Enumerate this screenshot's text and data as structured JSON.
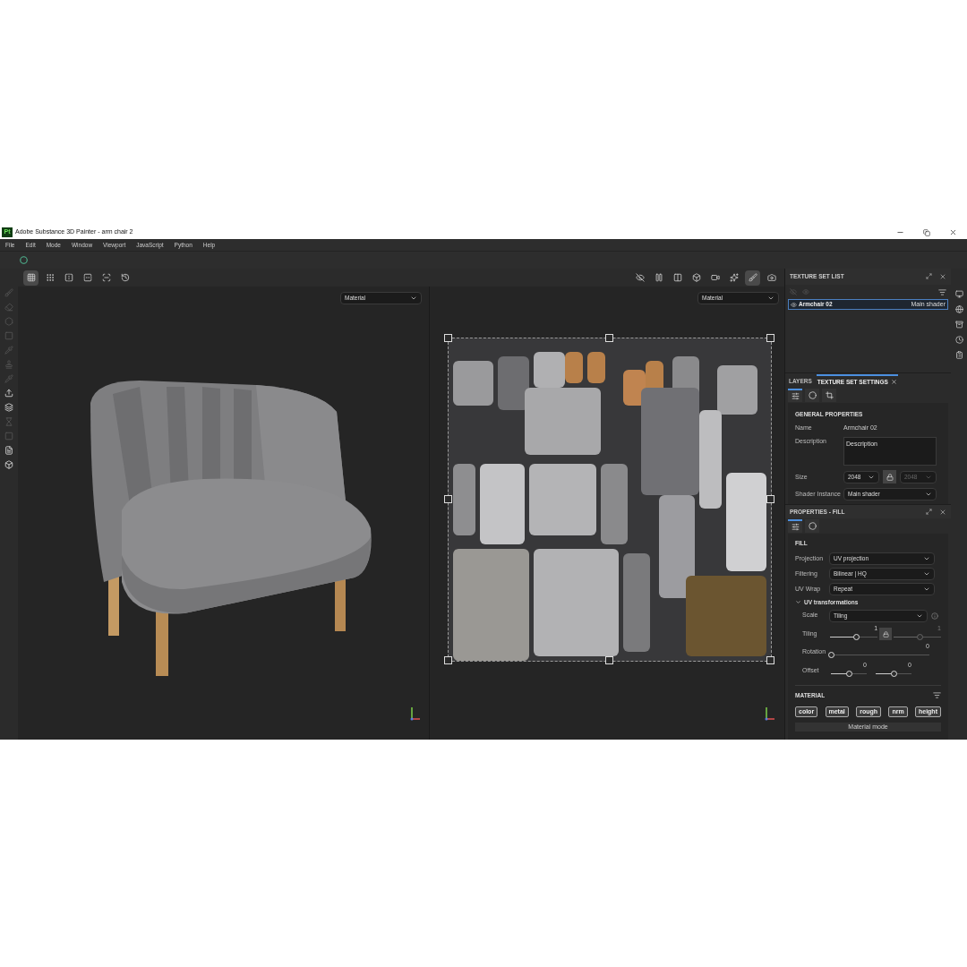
{
  "window": {
    "title": "Adobe Substance 3D Painter - arm chair 2",
    "app_badge": "Pt"
  },
  "menu": [
    "File",
    "Edit",
    "Mode",
    "Window",
    "Viewport",
    "JavaScript",
    "Python",
    "Help"
  ],
  "left_tools": [
    {
      "disabled": true
    },
    {
      "disabled": true
    },
    {
      "disabled": true
    },
    {
      "disabled": true
    },
    {
      "disabled": true
    },
    {
      "disabled": true
    },
    {
      "disabled": true
    },
    {
      "disabled": false
    },
    {
      "disabled": false
    },
    {
      "disabled": true
    },
    {
      "disabled": true
    },
    {
      "disabled": false
    },
    {
      "disabled": false
    }
  ],
  "viewport_tools_left": [
    {
      "selected": true
    },
    {
      "selected": false
    },
    {
      "selected": false
    },
    {
      "selected": false
    },
    {
      "selected": false
    },
    {
      "selected": false
    }
  ],
  "viewport_tools_right": [
    {
      "selected": false
    },
    {
      "selected": false
    },
    {
      "selected": false
    },
    {
      "selected": false
    },
    {
      "selected": false
    },
    {
      "selected": false
    },
    {
      "selected": true
    },
    {
      "selected": false
    }
  ],
  "viewport_3d": {
    "mode": "Material"
  },
  "viewport_2d": {
    "mode": "Material"
  },
  "texture_set_list": {
    "title": "TEXTURE SET LIST",
    "rows": [
      {
        "name": "Armchair 02",
        "shader": "Main shader",
        "selected": true
      }
    ]
  },
  "tabs": [
    {
      "label": "LAYERS",
      "selected": false
    },
    {
      "label": "TEXTURE SET SETTINGS",
      "selected": true
    }
  ],
  "settings_icon_tabs": [
    {
      "selected": true
    },
    {
      "selected": false
    },
    {
      "selected": false
    }
  ],
  "general_properties": {
    "title": "GENERAL PROPERTIES",
    "name_label": "Name",
    "name": "Armchair 02",
    "description_label": "Description",
    "description": "Description",
    "size_label": "Size",
    "size": "2048",
    "size_linked": "2048",
    "shader_label": "Shader Instance",
    "shader": "Main shader"
  },
  "properties": {
    "title": "PROPERTIES - FILL",
    "icon_tabs": [
      {
        "selected": true
      },
      {
        "selected": false
      }
    ],
    "section": "FILL",
    "fields": [
      {
        "label": "Projection",
        "value": "UV projection"
      },
      {
        "label": "Filtering",
        "value": "Bilinear | HQ"
      },
      {
        "label": "UV Wrap",
        "value": "Repeat"
      }
    ],
    "uv_group": {
      "title": "UV transformations",
      "expanded": true,
      "scale_label": "Scale",
      "scale": "Tiling",
      "tiling": {
        "label": "Tiling",
        "a": {
          "value": "1",
          "level": 0.55,
          "disabled": false
        },
        "b": {
          "value": "1",
          "level": 0.55,
          "disabled": true
        }
      },
      "rotation": {
        "label": "Rotation",
        "value": "0",
        "level": 0
      },
      "offset": {
        "label": "Offset",
        "a": {
          "value": "0",
          "level": 0.5,
          "disabled": false
        },
        "b": {
          "value": "0",
          "level": 0.5,
          "disabled": false
        }
      }
    },
    "material": {
      "title": "MATERIAL",
      "channels": [
        {
          "label": "color",
          "on": true
        },
        {
          "label": "metal",
          "on": true
        },
        {
          "label": "rough",
          "on": true
        },
        {
          "label": "nrm",
          "on": true
        },
        {
          "label": "height",
          "on": true
        }
      ],
      "mode_label": "Material mode"
    }
  }
}
